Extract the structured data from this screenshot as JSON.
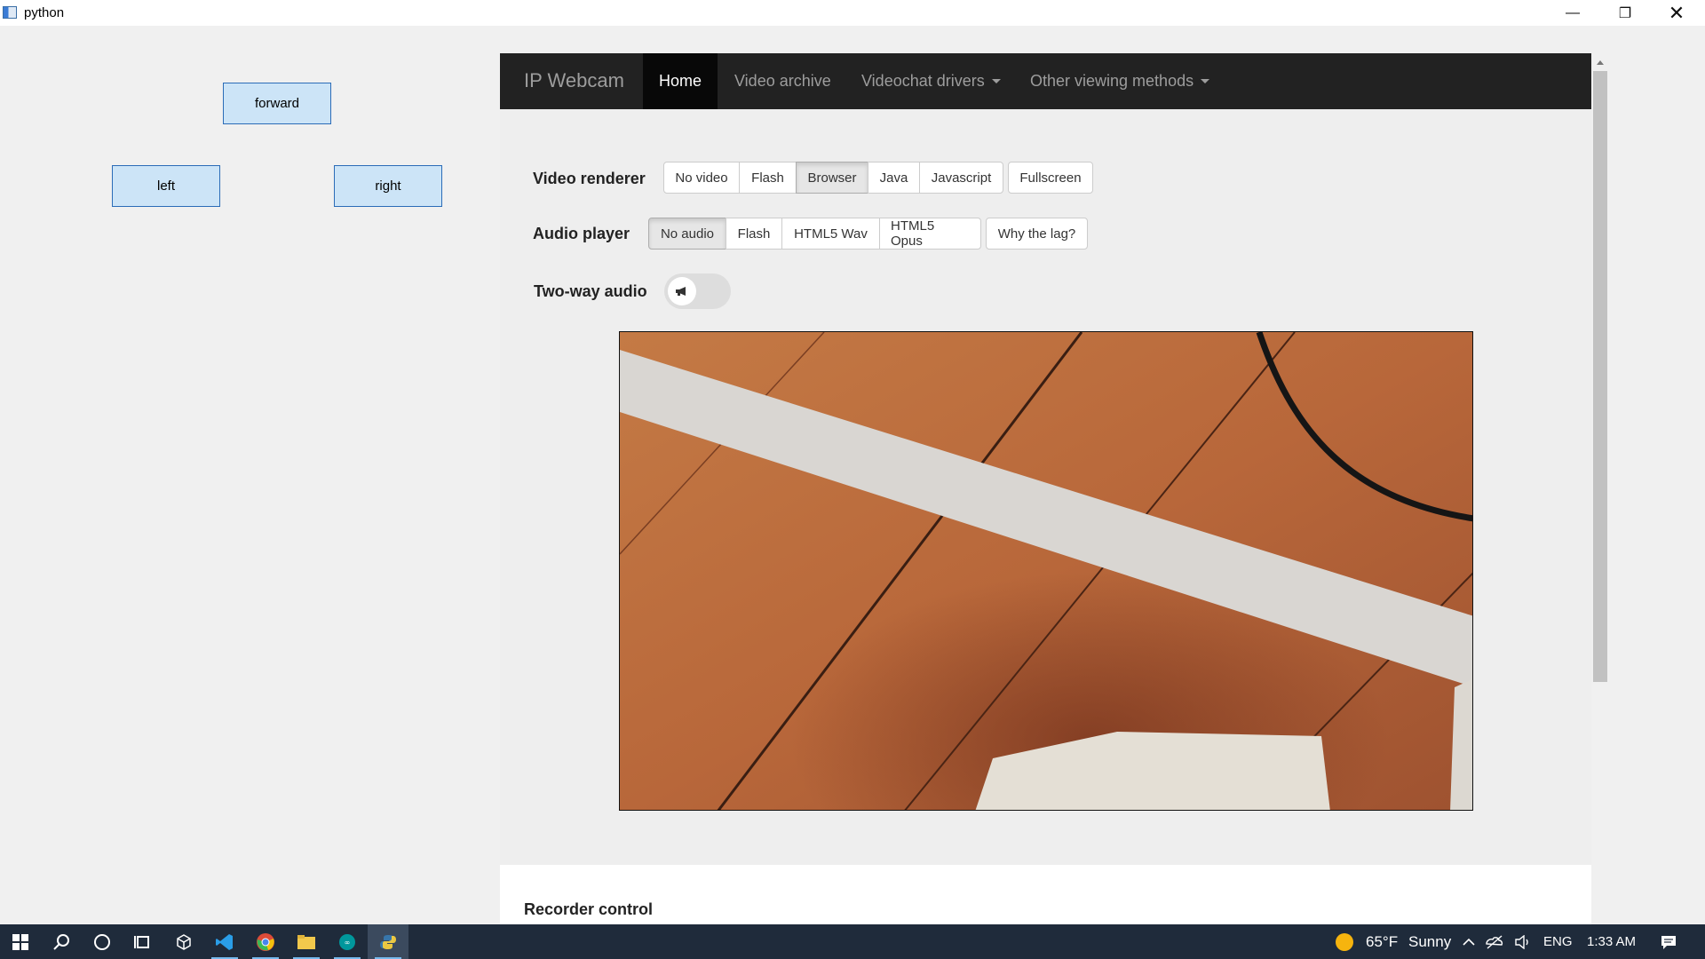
{
  "window": {
    "title": "python",
    "minimize": "—",
    "maximize": "❐",
    "close": "✕"
  },
  "controls": {
    "forward": "forward",
    "left": "left",
    "right": "right"
  },
  "navbar": {
    "brand": "IP Webcam",
    "items": [
      {
        "label": "Home",
        "active": true
      },
      {
        "label": "Video archive"
      },
      {
        "label": "Videochat drivers",
        "dropdown": true
      },
      {
        "label": "Other viewing methods",
        "dropdown": true
      }
    ]
  },
  "video_renderer": {
    "label": "Video renderer",
    "options": [
      "No video",
      "Flash",
      "Browser",
      "Java",
      "Javascript"
    ],
    "selected": "Browser",
    "fullscreen": "Fullscreen"
  },
  "audio_player": {
    "label": "Audio player",
    "options": [
      "No audio",
      "Flash",
      "HTML5 Wav",
      "HTML5 Opus"
    ],
    "selected": "No audio",
    "help": "Why the lag?"
  },
  "two_way_audio": {
    "label": "Two-way audio",
    "enabled": false
  },
  "recorder": {
    "title": "Recorder control"
  },
  "taskbar": {
    "icons": [
      "windows-start-icon",
      "search-icon",
      "cortana-icon",
      "task-view-icon",
      "3d-viewer-icon",
      "vscode-icon",
      "chrome-icon",
      "file-explorer-icon",
      "arduino-icon",
      "python-icon"
    ],
    "weather_temp": "65°F",
    "weather_desc": "Sunny",
    "language": "ENG",
    "time": "1:33 AM"
  },
  "colors": {
    "navbar": "#222222",
    "tk_button": "#cce4f7",
    "taskbar": "#1f2b3b"
  }
}
